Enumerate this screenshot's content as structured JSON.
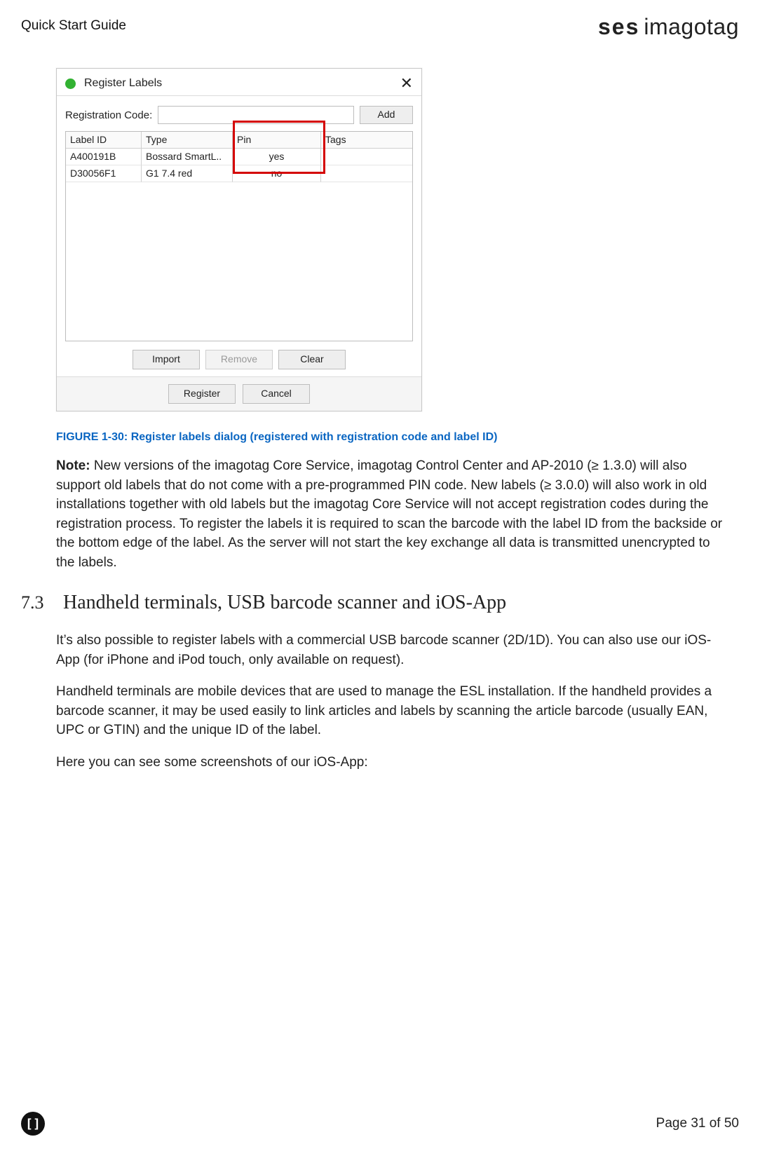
{
  "header": {
    "doc_title": "Quick Start Guide",
    "logo_ses": "ses",
    "logo_imagotag": "imagotag"
  },
  "dialog": {
    "title": "Register Labels",
    "close_glyph": "✕",
    "reg_label": "Registration Code:",
    "add_btn": "Add",
    "columns": {
      "id": "Label ID",
      "type": "Type",
      "pin": "Pin",
      "tags": "Tags"
    },
    "rows": [
      {
        "id": "A400191B",
        "type": "Bossard SmartL..",
        "pin": "yes",
        "tags": ""
      },
      {
        "id": "D30056F1",
        "type": "G1 7.4 red",
        "pin": "no",
        "tags": ""
      }
    ],
    "mid_buttons": {
      "import": "Import",
      "remove": "Remove",
      "clear": "Clear"
    },
    "bottom_buttons": {
      "register": "Register",
      "cancel": "Cancel"
    }
  },
  "figure_caption": "FIGURE 1-30: Register labels dialog (registered with registration code and label ID)",
  "note": {
    "label": "Note:",
    "text": " New versions of the imagotag Core Service, imagotag Control Center and AP-2010 (≥ 1.3.0) will also support old labels that do not come with a pre-programmed PIN code. New labels (≥ 3.0.0) will also work in old installations together with old labels but the imagotag Core Service will not accept registration codes during the registration process. To register the labels it is required to scan the barcode with the label ID from the backside or the bottom edge of the label. As the server will not start the key exchange all data is transmitted unencrypted to the labels."
  },
  "section": {
    "number": "7.3",
    "title": "Handheld terminals, USB barcode scanner and iOS-App"
  },
  "paragraphs": {
    "p1": "It’s also possible to register labels with a commercial USB barcode scanner (2D/1D). You can also use our iOS-App (for iPhone and iPod touch, only available on request).",
    "p2": "Handheld terminals are mobile devices that are used to manage the ESL installation. If the handheld provides a barcode scanner, it may be used easily to link articles and labels by scanning the article barcode (usually EAN, UPC or GTIN) and the unique ID of the label.",
    "p3": "Here you can see some screenshots of our iOS-App:"
  },
  "footer": {
    "icon_text": "[]",
    "page_text": "Page 31 of 50"
  }
}
